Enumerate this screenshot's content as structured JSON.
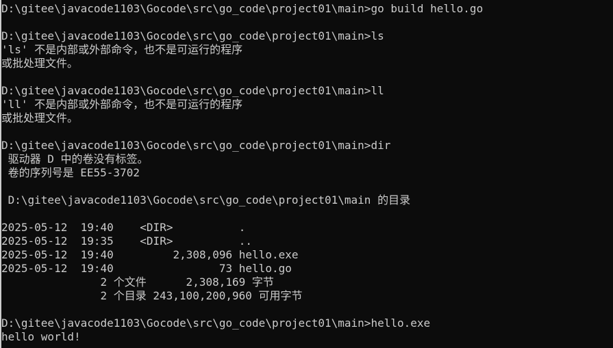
{
  "terminal": {
    "lines": [
      "D:\\gitee\\javacode1103\\Gocode\\src\\go_code\\project01\\main>go build hello.go",
      "",
      "D:\\gitee\\javacode1103\\Gocode\\src\\go_code\\project01\\main>ls",
      "'ls' 不是内部或外部命令，也不是可运行的程序",
      "或批处理文件。",
      "",
      "D:\\gitee\\javacode1103\\Gocode\\src\\go_code\\project01\\main>ll",
      "'ll' 不是内部或外部命令，也不是可运行的程序",
      "或批处理文件。",
      "",
      "D:\\gitee\\javacode1103\\Gocode\\src\\go_code\\project01\\main>dir",
      " 驱动器 D 中的卷没有标签。",
      " 卷的序列号是 EE55-3702",
      "",
      " D:\\gitee\\javacode1103\\Gocode\\src\\go_code\\project01\\main 的目录",
      "",
      "2025-05-12  19:40    <DIR>          .",
      "2025-05-12  19:35    <DIR>          ..",
      "2025-05-12  19:40         2,308,096 hello.exe",
      "2025-05-12  19:40                73 hello.go",
      "               2 个文件      2,308,169 字节",
      "               2 个目录 243,100,200,960 可用字节",
      "",
      "D:\\gitee\\javacode1103\\Gocode\\src\\go_code\\project01\\main>hello.exe",
      "hello world!"
    ]
  }
}
